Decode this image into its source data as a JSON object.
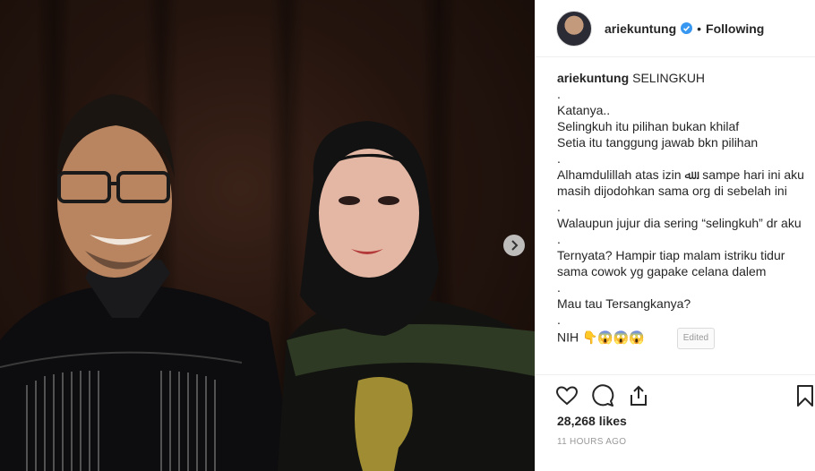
{
  "post": {
    "image_alt": "",
    "next_icon": "chevron-right-icon"
  },
  "header": {
    "username": "ariekuntung",
    "verified_icon": "verified-badge-icon",
    "separator": "•",
    "follow_state": "Following"
  },
  "caption": {
    "owner": "ariekuntung",
    "first_line": "SELINGKUH",
    "lines": [
      ".",
      "Katanya..",
      "Selingkuh itu pilihan bukan khilaf",
      "Setia itu tanggung jawab bkn pilihan",
      ".",
      "Alhamdulillah atas izin ﷲ . sampe hari ini aku masih dijodohkan sama org di sebelah ini",
      ".",
      "Walaupun jujur dia sering “selingkuh” dr aku",
      ".",
      "Ternyata? Hampir tiap malam istriku tidur sama cowok yg gapake celana dalem",
      ".",
      "Mau tau Tersangkanya?",
      ".",
      "NIH 👇😱😱😱"
    ],
    "edited_label": "Edited"
  },
  "actions": {
    "like_icon": "heart-icon",
    "comment_icon": "comment-icon",
    "share_icon": "share-icon",
    "save_icon": "bookmark-icon"
  },
  "likes": "28,268 likes",
  "timestamp": "11 HOURS AGO",
  "colors": {
    "text": "#262626",
    "muted": "#999999",
    "verified": "#3897f0",
    "border": "#efefef"
  }
}
